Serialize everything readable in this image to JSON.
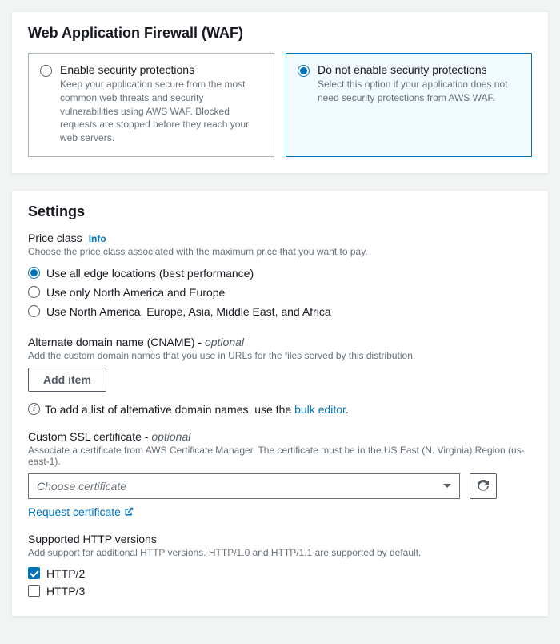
{
  "waf": {
    "title": "Web Application Firewall (WAF)",
    "options": [
      {
        "title": "Enable security protections",
        "desc": "Keep your application secure from the most common web threats and security vulnerabilities using AWS WAF. Blocked requests are stopped before they reach your web servers.",
        "selected": false
      },
      {
        "title": "Do not enable security protections",
        "desc": "Select this option if your application does not need security protections from AWS WAF.",
        "selected": true
      }
    ]
  },
  "settings": {
    "title": "Settings",
    "price_class": {
      "label": "Price class",
      "info": "Info",
      "desc": "Choose the price class associated with the maximum price that you want to pay.",
      "options": [
        "Use all edge locations (best performance)",
        "Use only North America and Europe",
        "Use North America, Europe, Asia, Middle East, and Africa"
      ],
      "selected_index": 0
    },
    "cname": {
      "label": "Alternate domain name (CNAME) -",
      "optional": "optional",
      "desc": "Add the custom domain names that you use in URLs for the files served by this distribution.",
      "button": "Add item",
      "helper_pre": "To add a list of alternative domain names, use the ",
      "helper_link": "bulk editor",
      "helper_post": "."
    },
    "ssl": {
      "label": "Custom SSL certificate -",
      "optional": "optional",
      "desc": "Associate a certificate from AWS Certificate Manager. The certificate must be in the US East (N. Virginia) Region (us-east-1).",
      "placeholder": "Choose certificate",
      "request_link": "Request certificate"
    },
    "http": {
      "label": "Supported HTTP versions",
      "desc": "Add support for additional HTTP versions. HTTP/1.0 and HTTP/1.1 are supported by default.",
      "options": [
        {
          "label": "HTTP/2",
          "checked": true
        },
        {
          "label": "HTTP/3",
          "checked": false
        }
      ]
    }
  }
}
